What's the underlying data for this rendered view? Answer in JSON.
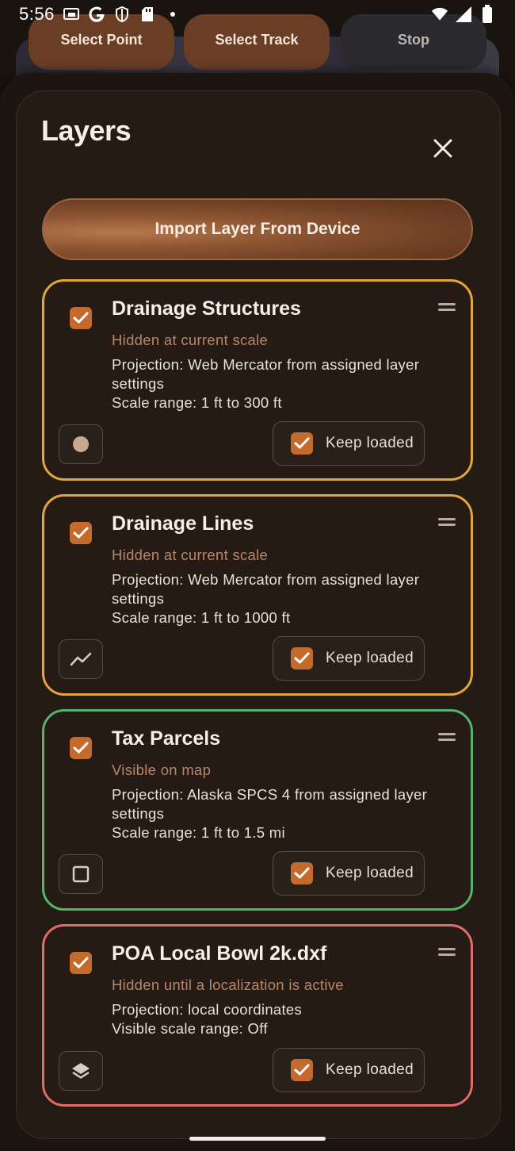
{
  "status_bar": {
    "time": "5:56",
    "left_icons": [
      "cast-icon",
      "google-icon",
      "shield-icon",
      "sd-card-icon",
      "dot-icon"
    ],
    "right_icons": [
      "wifi-icon",
      "signal-icon",
      "battery-icon"
    ]
  },
  "background": {
    "buttons": [
      "Select Point",
      "Select Track",
      "Stop"
    ]
  },
  "sheet": {
    "title": "Layers",
    "import_label": "Import Layer From Device",
    "keep_loaded_label": "Keep loaded",
    "accent_color": "#c56a2d"
  },
  "layers": [
    {
      "name": "Drainage Structures",
      "checked": true,
      "status": "Hidden at current scale",
      "projection": "Projection: Web Mercator from assigned layer settings",
      "scale": "Scale range: 1 ft to 300 ft",
      "geometry_icon": "point-icon",
      "keep_loaded": true,
      "border_color": "#e3a63c"
    },
    {
      "name": "Drainage Lines",
      "checked": true,
      "status": "Hidden at current scale",
      "projection": "Projection: Web Mercator from assigned layer settings",
      "scale": "Scale range: 1 ft to 1000 ft",
      "geometry_icon": "line-icon",
      "keep_loaded": true,
      "border_color": "#e3a63c"
    },
    {
      "name": "Tax Parcels",
      "checked": true,
      "status": "Visible on map",
      "projection": "Projection: Alaska SPCS 4 from assigned layer settings",
      "scale": "Scale range: 1 ft to 1.5 mi",
      "geometry_icon": "polygon-icon",
      "keep_loaded": true,
      "border_color": "#54b56a"
    },
    {
      "name": "POA Local Bowl 2k.dxf",
      "checked": true,
      "status": "Hidden until a localization is active",
      "projection": "Projection: local coordinates",
      "scale": "Visible scale range: Off",
      "geometry_icon": "layers-icon",
      "keep_loaded": true,
      "border_color": "#e06b6b"
    }
  ]
}
